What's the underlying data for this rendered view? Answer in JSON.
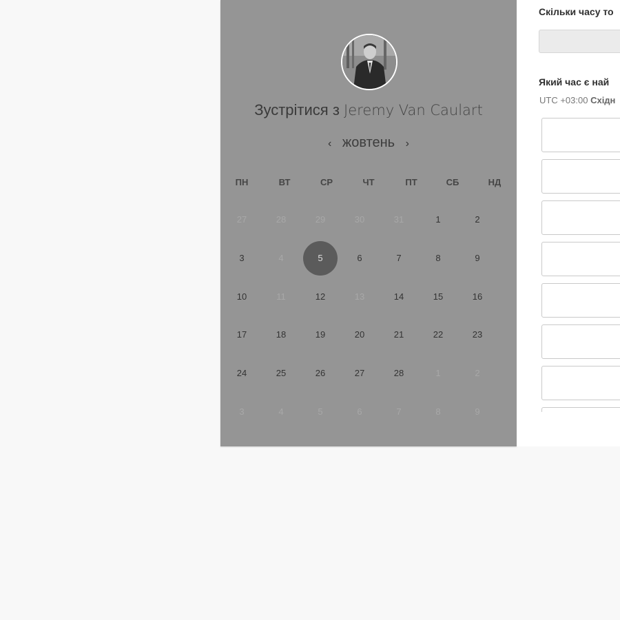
{
  "scheduler": {
    "title_prefix": "Зустрітися з ",
    "host_name": "Jeremy Van Caulart",
    "month": "жовтень",
    "prev_arrow": "‹",
    "next_arrow": "›",
    "weekdays": [
      "ПН",
      "ВТ",
      "СР",
      "ЧТ",
      "ПТ",
      "СБ",
      "НД"
    ],
    "weeks": [
      [
        {
          "d": "27",
          "m": true
        },
        {
          "d": "28",
          "m": true
        },
        {
          "d": "29",
          "m": true
        },
        {
          "d": "30",
          "m": true
        },
        {
          "d": "31",
          "m": true
        },
        {
          "d": "1"
        },
        {
          "d": "2"
        }
      ],
      [
        {
          "d": "3"
        },
        {
          "d": "4",
          "m": true
        },
        {
          "d": "5",
          "s": true
        },
        {
          "d": "6"
        },
        {
          "d": "7"
        },
        {
          "d": "8"
        },
        {
          "d": "9"
        }
      ],
      [
        {
          "d": "10"
        },
        {
          "d": "11",
          "m": true
        },
        {
          "d": "12"
        },
        {
          "d": "13",
          "m": true
        },
        {
          "d": "14"
        },
        {
          "d": "15"
        },
        {
          "d": "16"
        }
      ],
      [
        {
          "d": "17"
        },
        {
          "d": "18"
        },
        {
          "d": "19"
        },
        {
          "d": "20"
        },
        {
          "d": "21"
        },
        {
          "d": "22"
        },
        {
          "d": "23"
        }
      ],
      [
        {
          "d": "24"
        },
        {
          "d": "25"
        },
        {
          "d": "26"
        },
        {
          "d": "27"
        },
        {
          "d": "28"
        },
        {
          "d": "1",
          "m": true
        },
        {
          "d": "2",
          "m": true
        }
      ],
      [
        {
          "d": "3",
          "m": true
        },
        {
          "d": "4",
          "m": true
        },
        {
          "d": "5",
          "m": true
        },
        {
          "d": "6",
          "m": true
        },
        {
          "d": "7",
          "m": true
        },
        {
          "d": "8",
          "m": true
        },
        {
          "d": "9",
          "m": true
        }
      ]
    ]
  },
  "booking": {
    "duration_question": "Скільки часу то",
    "time_question": "Який час є най",
    "timezone_offset": "UTC +03:00",
    "timezone_name": "Східн",
    "slot_count_visible": 8
  },
  "colors": {
    "panel_bg": "#959595",
    "selected_day": "#5b5b5b",
    "page_bg": "#f8f8f8"
  }
}
